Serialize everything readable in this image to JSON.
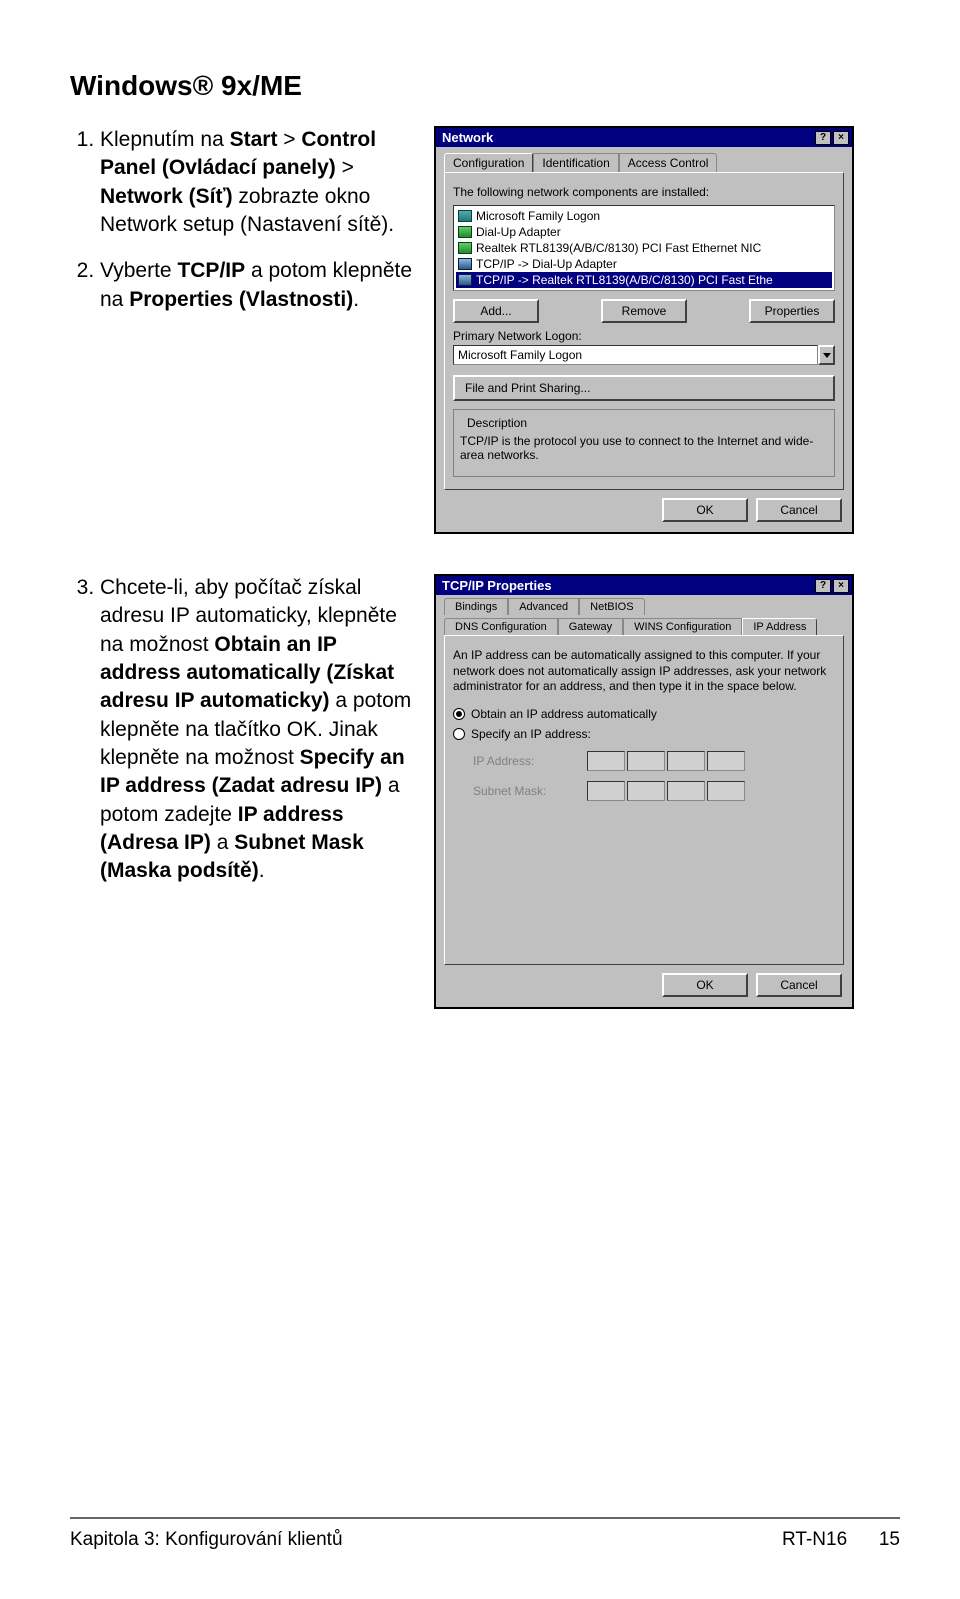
{
  "heading": "Windows® 9x/ME",
  "steps": {
    "step1_parts": {
      "t1": "Klepnutím na ",
      "start": "Start",
      "gt": " > ",
      "control_panel": "Control Panel (Ovládací panely)",
      "t2": " > ",
      "network": "Network (Síť)",
      "t3": " zobrazte okno Network setup (Nastavení sítě)."
    },
    "step2_parts": {
      "t1": "Vyberte ",
      "tcpip": "TCP/IP",
      "t2": " a potom klepněte na ",
      "properties": "Properties (Vlastnosti)",
      "t3": "."
    },
    "step3_parts": {
      "t1": "Chcete-li, aby počítač získal adresu IP automaticky, klepněte na možnost ",
      "obtain": "Obtain an IP address automatically (Získat adresu IP automaticky)",
      "t2": " a potom klepněte na tlačítko OK. Jinak klepněte na možnost ",
      "specify": "Specify an IP address (Zadat adresu IP)",
      "t3": " a potom zadejte ",
      "ipaddr": "IP address (Adresa IP)",
      "t4": " a ",
      "subnet": "Subnet Mask (Maska podsítě)",
      "t5": "."
    }
  },
  "dlg1": {
    "title": "Network",
    "tabs": [
      "Configuration",
      "Identification",
      "Access Control"
    ],
    "note": "The following network components are installed:",
    "items": [
      "Microsoft Family Logon",
      "Dial-Up Adapter",
      "Realtek RTL8139(A/B/C/8130) PCI Fast Ethernet NIC",
      "TCP/IP -> Dial-Up Adapter",
      "TCP/IP -> Realtek RTL8139(A/B/C/8130) PCI Fast Ethe"
    ],
    "btn_add": "Add...",
    "btn_remove": "Remove",
    "btn_properties": "Properties",
    "primary_logon_label": "Primary Network Logon:",
    "primary_logon_value": "Microsoft Family Logon",
    "file_print": "File and Print Sharing...",
    "desc_label": "Description",
    "desc": "TCP/IP is the protocol you use to connect to the Internet and wide-area networks.",
    "ok": "OK",
    "cancel": "Cancel"
  },
  "dlg2": {
    "title": "TCP/IP Properties",
    "tabs_row1": [
      "Bindings",
      "Advanced",
      "NetBIOS"
    ],
    "tabs_row2": [
      "DNS Configuration",
      "Gateway",
      "WINS Configuration",
      "IP Address"
    ],
    "para": "An IP address can be automatically assigned to this computer. If your network does not automatically assign IP addresses, ask your network administrator for an address, and then type it in the space below.",
    "radio_auto": "Obtain an IP address automatically",
    "radio_specify": "Specify an IP address:",
    "ip_label": "IP Address:",
    "subnet_label": "Subnet Mask:",
    "ok": "OK",
    "cancel": "Cancel"
  },
  "footer": {
    "label": "Kapitola 3: Konfigurování klientů",
    "model": "RT-N16",
    "page": "15"
  }
}
